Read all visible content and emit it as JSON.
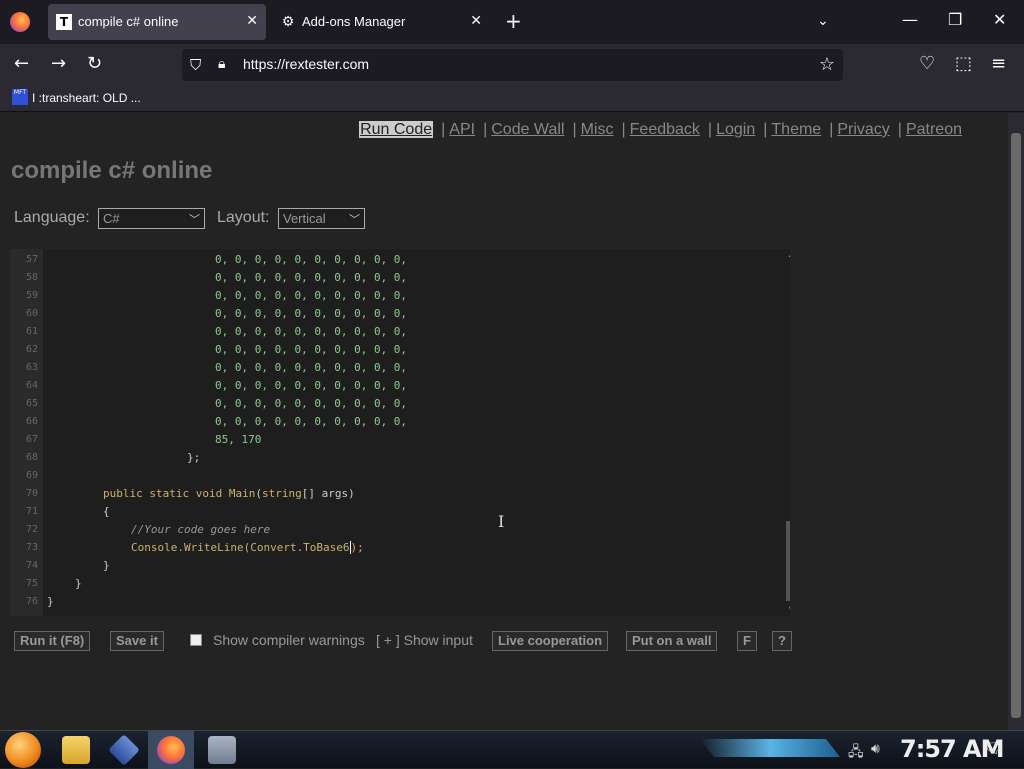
{
  "browser": {
    "tabs": [
      {
        "favicon": "T",
        "title": "compile c# online",
        "active": true
      },
      {
        "favicon": "puzzle-icon",
        "title": "Add-ons Manager",
        "active": false
      }
    ],
    "url": "https://rextester.com",
    "bookmark": {
      "icon_text": "MFT",
      "label": "I :transheart: OLD ..."
    }
  },
  "site": {
    "nav": [
      {
        "label": "Run Code",
        "current": true
      },
      {
        "label": "API"
      },
      {
        "label": "Code Wall"
      },
      {
        "label": "Misc"
      },
      {
        "label": "Feedback"
      },
      {
        "label": "Login"
      },
      {
        "label": "Theme"
      },
      {
        "label": "Privacy"
      },
      {
        "label": "Patreon"
      }
    ],
    "title": "compile c# online",
    "language_label": "Language:",
    "language_value": "C#",
    "layout_label": "Layout:",
    "layout_value": "Vertical"
  },
  "editor": {
    "line_numbers": [
      "57",
      "58",
      "59",
      "60",
      "61",
      "62",
      "63",
      "64",
      "65",
      "66",
      "67",
      "68",
      "69",
      "70",
      "71",
      "72",
      "73",
      "74",
      "75",
      "76"
    ],
    "zero_row": "0, 0, 0, 0, 0, 0, 0, 0, 0, 0,",
    "last_values": "85, 170",
    "close_array": "};",
    "main_keywords": "public static void",
    "main_name": "Main",
    "main_param_type": "string",
    "main_params_rest": "[] args)",
    "open_brace": "{",
    "comment": "//Your code goes here",
    "statement_prefix": "Console.WriteLine(Convert.ToBase6",
    "statement_suffix": ");",
    "close_inner": "}",
    "close_class": "}",
    "close_ns": "}"
  },
  "actions": {
    "run": "Run it (F8)",
    "save": "Save it",
    "show_warnings": "Show compiler warnings",
    "show_input": "[ + ] Show input",
    "live": "Live cooperation",
    "wall": "Put on a wall",
    "f": "F",
    "help": "?"
  },
  "taskbar": {
    "clock": "7:57 AM"
  }
}
